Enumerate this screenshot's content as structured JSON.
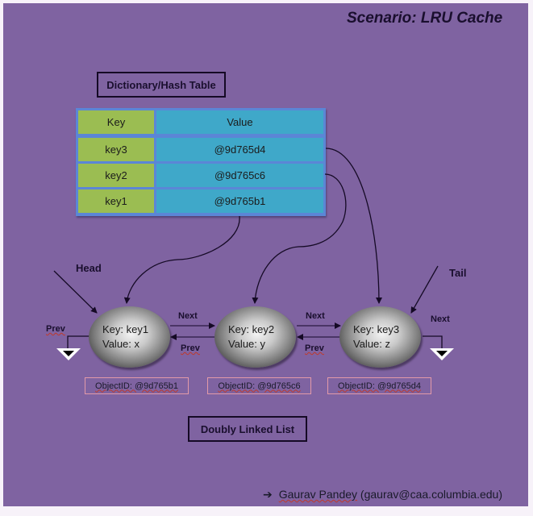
{
  "title": "Scenario: LRU Cache",
  "hash_table": {
    "label": "Dictionary/Hash Table",
    "headers": {
      "key": "Key",
      "value": "Value"
    },
    "rows": [
      {
        "key": "key3",
        "value": "@9d765d4"
      },
      {
        "key": "key2",
        "value": "@9d765c6"
      },
      {
        "key": "key1",
        "value": "@9d765b1"
      }
    ]
  },
  "linked_list": {
    "label": "Doubly Linked List",
    "head_label": "Head",
    "tail_label": "Tail",
    "nodes": [
      {
        "key_line": "Key: key1",
        "value_line": "Value: x",
        "object_id": "ObjectID: @9d765b1"
      },
      {
        "key_line": "Key: key2",
        "value_line": "Value: y",
        "object_id": "ObjectID: @9d765c6"
      },
      {
        "key_line": "Key: key3",
        "value_line": "Value: z",
        "object_id": "ObjectID: @9d765d4"
      }
    ],
    "pointer_labels": {
      "next": "Next",
      "prev": "Prev"
    }
  },
  "author": {
    "arrow": "➔",
    "name": "Gaurav Pandey",
    "email": "(gaurav@caa.columbia.edu)"
  },
  "colors": {
    "background": "#7f63a1",
    "key_cell": "#9bbd52",
    "value_cell": "#3fa8c9",
    "table_border": "#5b86d6",
    "object_id_border": "#e39aa8"
  }
}
